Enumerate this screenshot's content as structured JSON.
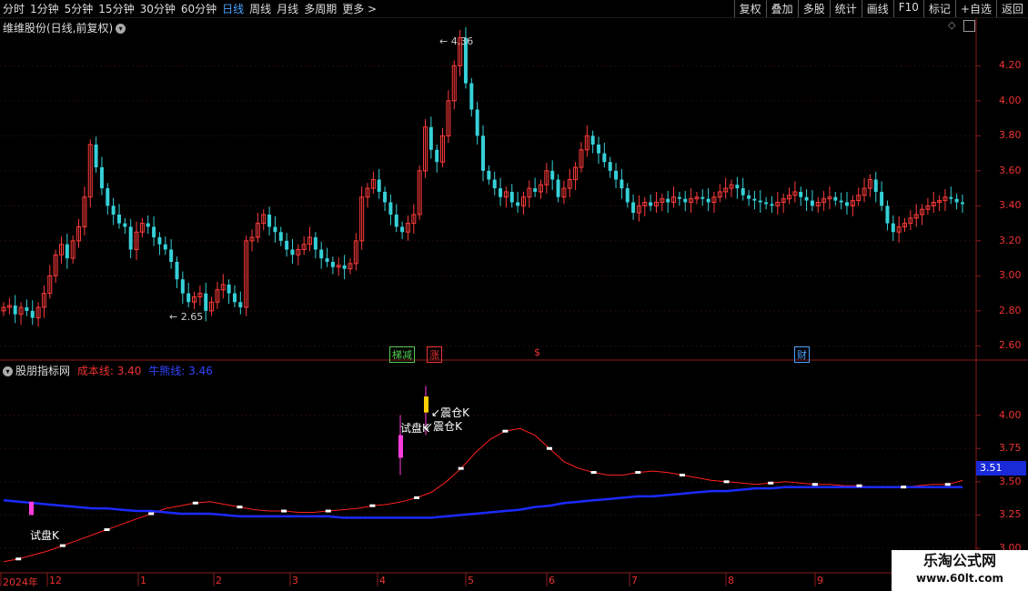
{
  "toolbar": {
    "periods": [
      "分时",
      "1分钟",
      "5分钟",
      "15分钟",
      "30分钟",
      "60分钟",
      "日线",
      "周线",
      "月线",
      "多周期",
      "更多 >"
    ],
    "active_period": "日线",
    "actions": [
      "复权",
      "叠加",
      "多股",
      "统计",
      "画线",
      "F10",
      "标记",
      "+自选",
      "返回"
    ]
  },
  "main_panel": {
    "title": "维维股份(日线,前复权)",
    "high_label": "4.36",
    "low_label": "2.65",
    "event_markers": [
      "梯减",
      "涨",
      "$",
      "财"
    ]
  },
  "indicator_panel": {
    "title": "股朋指标网",
    "cost_line_label": "成本线:",
    "cost_line_value": "3.40",
    "bull_bear_label": "牛熊线:",
    "bull_bear_value": "3.46",
    "current_value_box": "3.51",
    "annotations": [
      "试盘K",
      "试盘K",
      "震仓K",
      "震仓K"
    ]
  },
  "axis": {
    "price_ticks": [
      "4.20",
      "4.00",
      "3.80",
      "3.60",
      "3.40",
      "3.20",
      "3.00",
      "2.80",
      "2.60"
    ],
    "indicator_ticks": [
      "4.00",
      "3.75",
      "3.50",
      "3.25",
      "3.00"
    ],
    "x_labels": [
      "2024年",
      "12",
      "1",
      "2",
      "3",
      "4",
      "5",
      "6",
      "7",
      "8",
      "9"
    ]
  },
  "chart_data": {
    "type": "candlestick",
    "price_range": [
      2.55,
      4.42
    ],
    "closes": [
      2.82,
      2.83,
      2.78,
      2.82,
      2.8,
      2.76,
      2.82,
      2.9,
      3,
      3.12,
      3.18,
      3.1,
      3.2,
      3.28,
      3.45,
      3.75,
      3.62,
      3.5,
      3.4,
      3.35,
      3.3,
      3.28,
      3.15,
      3.25,
      3.3,
      3.28,
      3.22,
      3.18,
      3.15,
      3.08,
      2.98,
      2.9,
      2.85,
      2.88,
      2.9,
      2.8,
      2.85,
      2.92,
      2.95,
      2.9,
      2.85,
      2.82,
      3.2,
      3.22,
      3.3,
      3.35,
      3.28,
      3.25,
      3.2,
      3.15,
      3.12,
      3.15,
      3.18,
      3.22,
      3.15,
      3.1,
      3.08,
      3.05,
      3.06,
      3.04,
      3.07,
      3.2,
      3.45,
      3.5,
      3.55,
      3.48,
      3.42,
      3.35,
      3.28,
      3.25,
      3.3,
      3.35,
      3.6,
      3.85,
      3.72,
      3.65,
      3.8,
      4,
      4.2,
      4.36,
      4.1,
      3.95,
      3.8,
      3.6,
      3.55,
      3.5,
      3.45,
      3.48,
      3.42,
      3.4,
      3.45,
      3.5,
      3.48,
      3.52,
      3.6,
      3.55,
      3.45,
      3.5,
      3.55,
      3.62,
      3.72,
      3.8,
      3.75,
      3.7,
      3.65,
      3.6,
      3.55,
      3.5,
      3.42,
      3.36,
      3.4,
      3.42,
      3.4,
      3.42,
      3.44,
      3.42,
      3.45,
      3.44,
      3.42,
      3.44,
      3.45,
      3.44,
      3.42,
      3.45,
      3.48,
      3.5,
      3.52,
      3.5,
      3.46,
      3.44,
      3.43,
      3.42,
      3.41,
      3.4,
      3.42,
      3.44,
      3.46,
      3.48,
      3.45,
      3.43,
      3.4,
      3.42,
      3.44,
      3.45,
      3.43,
      3.42,
      3.4,
      3.43,
      3.46,
      3.5,
      3.55,
      3.48,
      3.4,
      3.3,
      3.25,
      3.28,
      3.3,
      3.33,
      3.35,
      3.38,
      3.4,
      3.42,
      3.43,
      3.45,
      3.44,
      3.42,
      3.41
    ],
    "cost_line": [
      3.36,
      3.35,
      3.34,
      3.33,
      3.32,
      3.31,
      3.3,
      3.3,
      3.29,
      3.28,
      3.28,
      3.27,
      3.26,
      3.26,
      3.26,
      3.25,
      3.24,
      3.24,
      3.24,
      3.24,
      3.24,
      3.24,
      3.24,
      3.23,
      3.23,
      3.23,
      3.23,
      3.23,
      3.23,
      3.23,
      3.24,
      3.25,
      3.26,
      3.27,
      3.28,
      3.29,
      3.31,
      3.32,
      3.34,
      3.35,
      3.36,
      3.37,
      3.38,
      3.39,
      3.39,
      3.4,
      3.41,
      3.42,
      3.43,
      3.43,
      3.44,
      3.45,
      3.45,
      3.46,
      3.46,
      3.46,
      3.46,
      3.46,
      3.46,
      3.46,
      3.46,
      3.46,
      3.46,
      3.46,
      3.46,
      3.46
    ],
    "bull_bear_line": [
      2.9,
      2.92,
      2.95,
      2.98,
      3.02,
      3.06,
      3.1,
      3.14,
      3.18,
      3.22,
      3.26,
      3.3,
      3.32,
      3.34,
      3.35,
      3.33,
      3.31,
      3.29,
      3.28,
      3.28,
      3.27,
      3.27,
      3.28,
      3.29,
      3.3,
      3.32,
      3.33,
      3.35,
      3.38,
      3.42,
      3.5,
      3.6,
      3.72,
      3.82,
      3.88,
      3.9,
      3.85,
      3.75,
      3.65,
      3.6,
      3.57,
      3.55,
      3.55,
      3.57,
      3.58,
      3.57,
      3.55,
      3.53,
      3.51,
      3.5,
      3.49,
      3.48,
      3.49,
      3.5,
      3.49,
      3.48,
      3.48,
      3.47,
      3.47,
      3.46,
      3.46,
      3.46,
      3.47,
      3.48,
      3.48,
      3.51
    ],
    "indicator_range": [
      2.85,
      4.25
    ]
  }
}
